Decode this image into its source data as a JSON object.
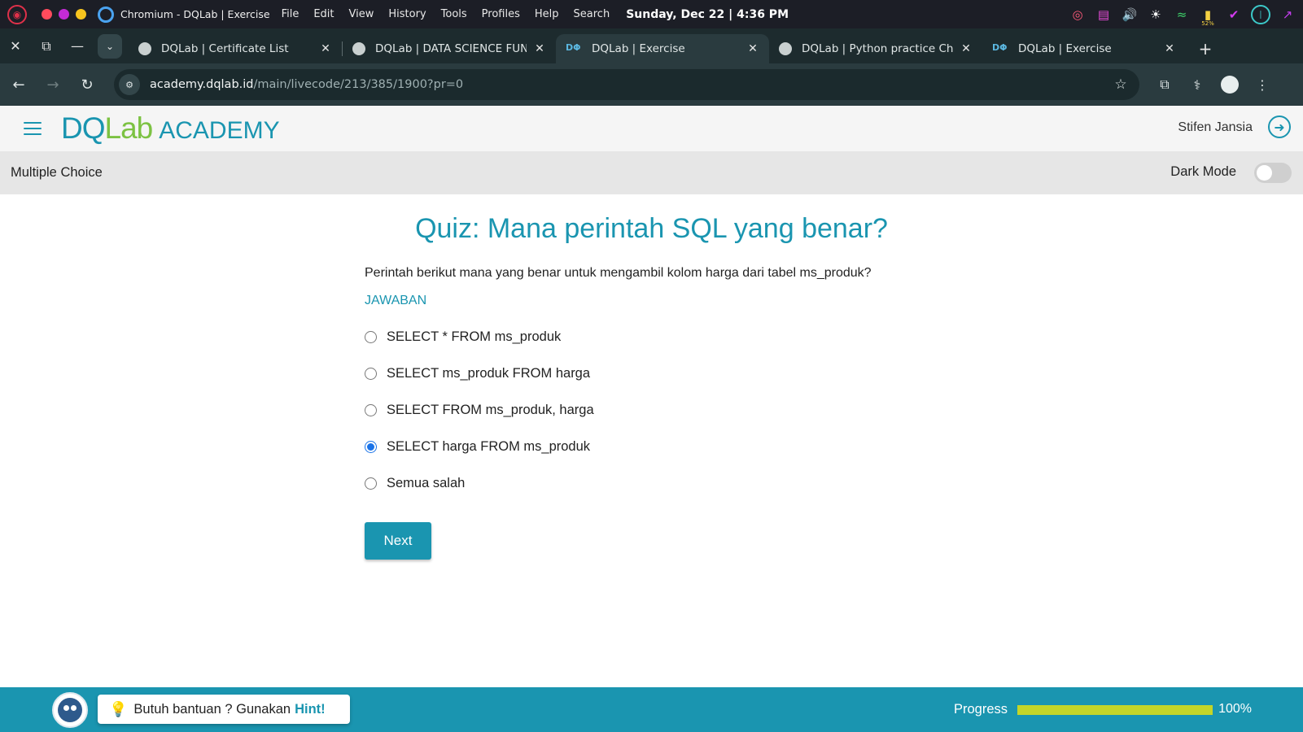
{
  "os": {
    "app_title": "Chromium - DQLab | Exercise",
    "menu": [
      "File",
      "Edit",
      "View",
      "History",
      "Tools",
      "Profiles",
      "Help",
      "Search"
    ],
    "clock": "Sunday, Dec 22 | 4:36 PM",
    "battery": "52%"
  },
  "tabs": [
    {
      "title": "DQLab | Certificate List",
      "favicon": "globe-icon",
      "active": false
    },
    {
      "title": "DQLab | DATA SCIENCE FUND",
      "favicon": "globe-icon",
      "active": false
    },
    {
      "title": "DQLab | Exercise",
      "favicon": "dqlab-icon",
      "active": true
    },
    {
      "title": "DQLab | Python practice Cha",
      "favicon": "globe-icon",
      "active": false
    },
    {
      "title": "DQLab | Exercise",
      "favicon": "dqlab-icon",
      "active": false
    }
  ],
  "address": {
    "host": "academy.dqlab.id",
    "path": "/main/livecode/213/385/1900?pr=0"
  },
  "header": {
    "logo_dq": "DQ",
    "logo_lab": "Lab",
    "logo_academy": "ACADEMY",
    "user_name": "Stifen Jansia"
  },
  "subheader": {
    "mode": "Multiple Choice",
    "dark_mode_label": "Dark Mode",
    "dark_mode_on": false
  },
  "quiz": {
    "title": "Quiz: Mana perintah SQL yang benar?",
    "question": "Perintah berikut mana yang benar untuk mengambil kolom harga dari tabel ms_produk?",
    "answer_label": "JAWABAN",
    "options": [
      {
        "label": "SELECT * FROM ms_produk",
        "checked": false
      },
      {
        "label": "SELECT ms_produk FROM harga",
        "checked": false
      },
      {
        "label": "SELECT FROM ms_produk, harga",
        "checked": false
      },
      {
        "label": "SELECT harga FROM ms_produk",
        "checked": true
      },
      {
        "label": "Semua salah",
        "checked": false
      }
    ],
    "next_label": "Next"
  },
  "footer": {
    "hint_text": "Butuh bantuan ? Gunakan",
    "hint_word": "Hint!",
    "progress_label": "Progress",
    "progress_value": "100%",
    "progress_fraction": 1.0
  },
  "colors": {
    "brand": "#1a95b0",
    "brand_green": "#7cc242",
    "progress": "#c3d528"
  }
}
